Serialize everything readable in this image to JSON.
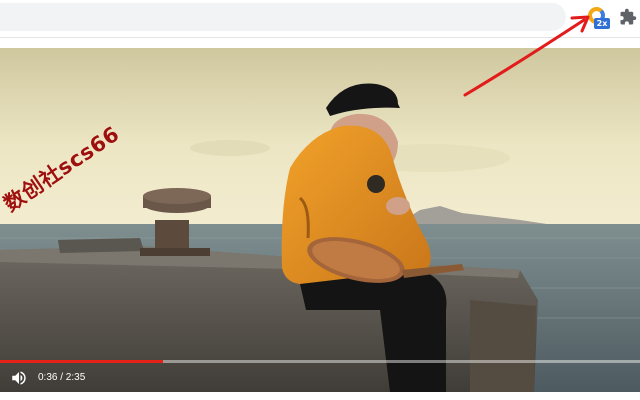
{
  "browser": {
    "omnibox_value": "",
    "extensions": [
      {
        "name": "speed-2x-extension",
        "badge": "2x",
        "icon": "2x-speed-icon"
      },
      {
        "name": "extensions-menu",
        "icon": "puzzle-icon"
      }
    ]
  },
  "video": {
    "watermark": "数创社scs66",
    "progress": 0.255,
    "current_time": "0:36",
    "duration": "2:35",
    "time_display": "0:36 / 2:35",
    "volume_icon": "volume-icon"
  },
  "colors": {
    "progress": "#e62117",
    "annotation_arrow": "#e21b1b",
    "badge": "#2f6fd6"
  }
}
